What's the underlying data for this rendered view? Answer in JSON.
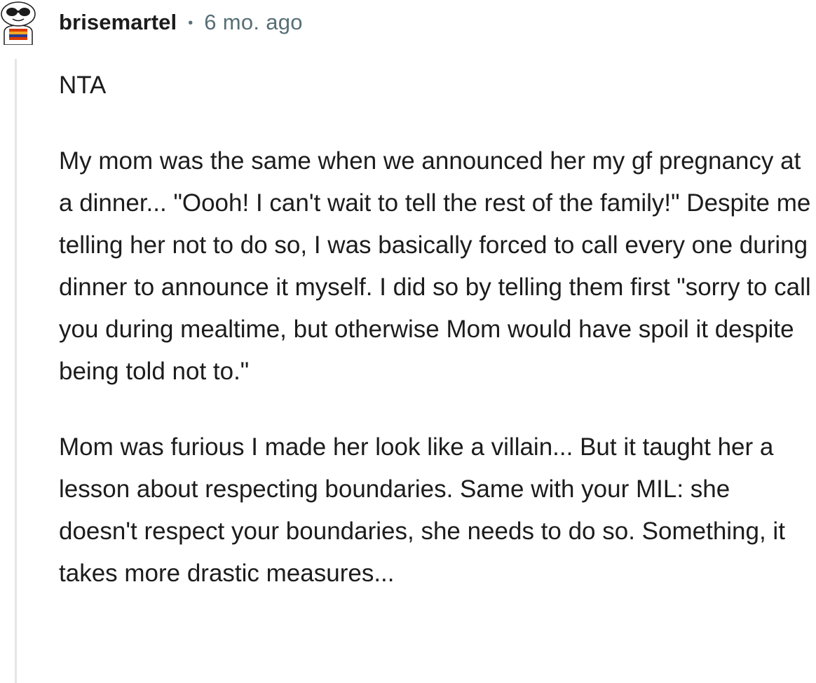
{
  "comment": {
    "author": "brisemartel",
    "separator": "•",
    "time_ago": "6 mo. ago",
    "paragraphs": [
      "NTA",
      "My mom was the same when we announced her my gf pregnancy at a dinner... \"Oooh! I can't wait to tell the rest of the family!\" Despite me telling her not to do so, I was basically forced to call every one during dinner to announce it myself. I did so by telling them first \"sorry to call you during mealtime, but otherwise Mom would have spoil it despite being told not to.\"",
      "Mom was furious I made her look like a villain... But it taught her a lesson about respecting boundaries. Same with your MIL: she doesn't respect your boundaries, she needs to do so. Something, it takes more drastic measures..."
    ]
  },
  "colors": {
    "text": "#1c1c1c",
    "meta": "#576f76",
    "thread_line": "#e3e6e8"
  },
  "icons": {
    "avatar": "snoo-avatar-with-sunglasses-icon"
  }
}
